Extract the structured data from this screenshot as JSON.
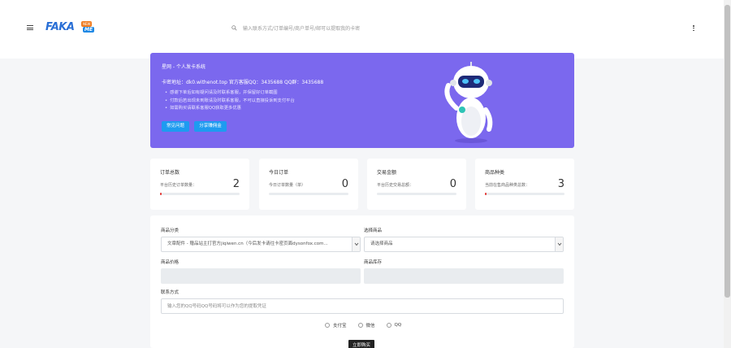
{
  "header": {
    "logo_text": "FAKA",
    "logo_badge": "NEW",
    "logo_suffix": "ME",
    "search_placeholder": "输入联系方式/订单编号/商户单号/邮可以提取我的卡密"
  },
  "banner": {
    "title": "星网 - 个人发卡系统",
    "info": "卡密地址：dk0.withenot.top    官方客服QQ：3435688    QQ群：3435688",
    "notices": [
      "感谢下单后如有疑问请及时联系客服，并保留好订单截图",
      "付款后若出现未到账请及时联系客服，不可以直接投诉到支付平台",
      "如需购买请联系客服QQ获取更多优惠"
    ],
    "faq_button": "常见问题",
    "share_button": "分享赚佣金",
    "colors": {
      "bg": "#7b68ee",
      "button": "#1e9bf0"
    }
  },
  "stats": [
    {
      "title": "订单总数",
      "sub": "平台历史订单数量：",
      "value": "2",
      "progress": 0.02
    },
    {
      "title": "今日订单",
      "sub": "今日订单数量（单）",
      "value": "0",
      "progress": 0
    },
    {
      "title": "交易金额",
      "sub": "平台历史交易总额：",
      "value": "0",
      "progress": 0
    },
    {
      "title": "商品种类",
      "sub": "当前在售商品种类总数：",
      "value": "3",
      "progress": 0.02
    }
  ],
  "form": {
    "category_label": "商品分类",
    "category_value": "文章配件 - 赠品站主打官方jiqiwen.cn（今后发卡请往卡密页面dysonfox.com...",
    "product_label": "选择商品",
    "product_value": "请选择商品",
    "price_label": "商品价格",
    "stock_label": "商品库存",
    "contact_label": "联系方式",
    "contact_placeholder": "输入您的QQ号码QQ号码将可以作为您的提取凭证",
    "payments": [
      "支付宝",
      "微信",
      "QQ"
    ],
    "buy_button": "立即购买"
  }
}
